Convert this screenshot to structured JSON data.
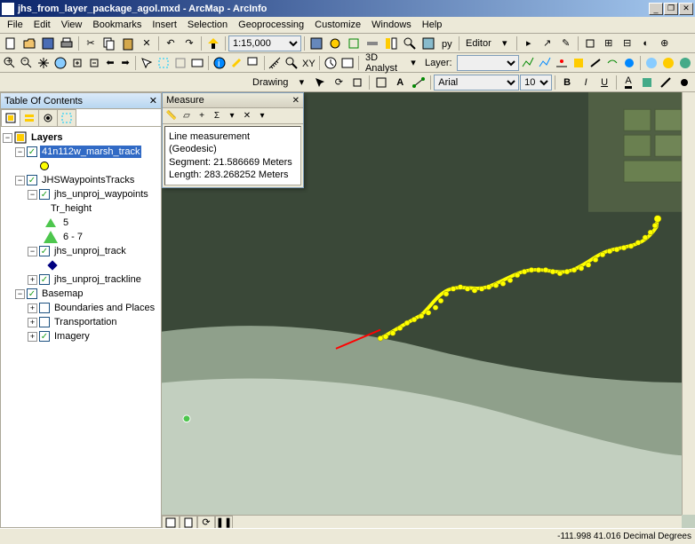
{
  "window": {
    "title": "jhs_from_layer_package_agol.mxd - ArcMap - ArcInfo"
  },
  "menus": [
    "File",
    "Edit",
    "View",
    "Bookmarks",
    "Insert",
    "Selection",
    "Geoprocessing",
    "Customize",
    "Windows",
    "Help"
  ],
  "toolbars": {
    "standard": {
      "scale": "1:15,000"
    },
    "editor": {
      "label": "Editor"
    },
    "analyst3d": {
      "label": "3D Analyst",
      "layerLabel": "Layer:"
    },
    "drawing": {
      "label": "Drawing",
      "font": "Arial",
      "size": "10"
    }
  },
  "toc": {
    "title": "Table Of Contents",
    "root": "Layers",
    "items": [
      {
        "name": "41n112w_marsh_track",
        "selected": true,
        "checked": true
      },
      {
        "name": "JHSWaypointsTracks",
        "checked": true
      },
      {
        "name": "jhs_unproj_waypoints",
        "checked": true
      },
      {
        "name": "Tr_height"
      },
      {
        "name": "5"
      },
      {
        "name": "6 - 7"
      },
      {
        "name": "jhs_unproj_track",
        "checked": true
      },
      {
        "name": "jhs_unproj_trackline",
        "checked": true
      },
      {
        "name": "Basemap",
        "checked": true
      },
      {
        "name": "Boundaries and Places",
        "checked": false
      },
      {
        "name": "Transportation",
        "checked": false
      },
      {
        "name": "Imagery",
        "checked": true
      }
    ]
  },
  "measure": {
    "title": "Measure",
    "line1": "Line measurement (Geodesic)",
    "line2": "Segment: 21.586669 Meters",
    "line3": "Length: 283.268252 Meters"
  },
  "status": {
    "coords": "-111.998  41.016 Decimal Degrees"
  }
}
